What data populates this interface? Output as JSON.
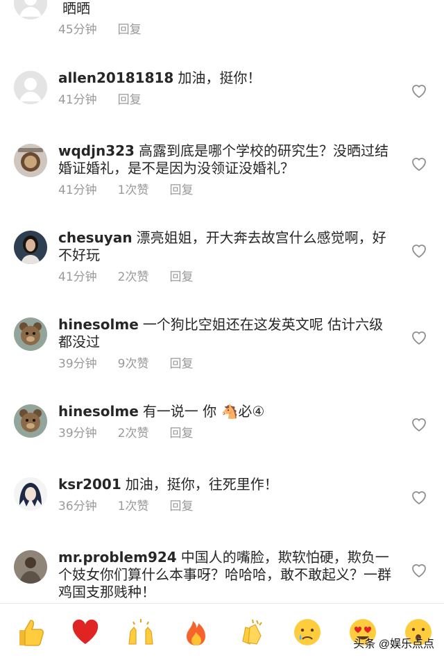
{
  "comments": [
    {
      "username": "",
      "text": "晒晒",
      "time": "45分钟",
      "likes": "",
      "reply": "回复"
    },
    {
      "username": "allen20181818",
      "text": "加油，挺你！",
      "time": "41分钟",
      "likes": "",
      "reply": "回复"
    },
    {
      "username": "wqdjn323",
      "text": "高露到底是哪个学校的研究生？没晒过结婚证婚礼，是不是因为没领证没婚礼？",
      "time": "41分钟",
      "likes": "1次赞",
      "reply": "回复"
    },
    {
      "username": "chesuyan",
      "text": "漂亮姐姐，开大奔去故宫什么感觉啊，好不好玩",
      "time": "41分钟",
      "likes": "2次赞",
      "reply": "回复"
    },
    {
      "username": "hinesolme",
      "text": "一个狗比空姐还在这发英文呢  估计六级都没过",
      "time": "39分钟",
      "likes": "9次赞",
      "reply": "回复"
    },
    {
      "username": "hinesolme",
      "text": "有一说一  你 🐴必④",
      "time": "39分钟",
      "likes": "2次赞",
      "reply": "回复"
    },
    {
      "username": "ksr2001",
      "text": "加油，挺你，往死里作！",
      "time": "36分钟",
      "likes": "1次赞",
      "reply": "回复"
    },
    {
      "username": "mr.problem924",
      "text": "中国人的嘴脸，欺软怕硬，欺负一个妓女你们算什么本事呀？哈哈哈，敢不敢起义？一群鸡国支那贱种！",
      "time": "",
      "likes": "",
      "reply": ""
    }
  ],
  "reactions": [
    "thumbs-up",
    "red-heart",
    "raising-hands",
    "fire",
    "clapping-hands",
    "crying-face",
    "heart-eyes-face",
    "surprised-face"
  ],
  "watermark": "头条 @娱乐点点",
  "colors": {
    "meta": "#999999",
    "text": "#262626"
  }
}
